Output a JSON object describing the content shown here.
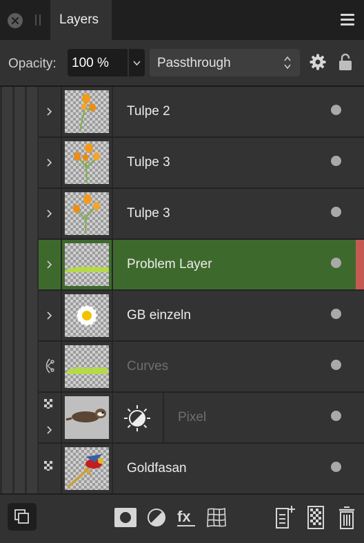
{
  "panel": {
    "tab_label": "Layers"
  },
  "toolbar": {
    "opacity_label": "Opacity:",
    "opacity_value": "100 %",
    "blend_mode": "Passthrough"
  },
  "layers": [
    {
      "name": "Tulpe 2",
      "expandable": true,
      "selected": false,
      "visible": true
    },
    {
      "name": "Tulpe 3",
      "expandable": true,
      "selected": false,
      "visible": true
    },
    {
      "name": "Tulpe 3",
      "expandable": true,
      "selected": false,
      "visible": true
    },
    {
      "name": "Problem Layer",
      "expandable": true,
      "selected": true,
      "visible": true
    },
    {
      "name": "GB einzeln",
      "expandable": true,
      "selected": false,
      "visible": true
    },
    {
      "name": "Curves",
      "expandable": false,
      "selected": false,
      "visible": true,
      "dimmed": true
    },
    {
      "name": "Pixel",
      "expandable": true,
      "selected": false,
      "visible": true,
      "dimmed": true
    },
    {
      "name": "Goldfasan",
      "expandable": false,
      "selected": false,
      "visible": true
    }
  ],
  "colors": {
    "selected_row": "#3d6a2c",
    "marker": "#c55a52"
  },
  "icons": {
    "close": "close-icon",
    "menu": "hamburger-menu-icon",
    "gear": "gear-icon",
    "lock": "lock-icon",
    "bottom": [
      "pages-icon",
      "mask-icon",
      "adjustment-icon",
      "fx-icon",
      "mesh-warp-icon",
      "add-layer-icon",
      "pixel-layer-icon",
      "trash-icon"
    ]
  }
}
